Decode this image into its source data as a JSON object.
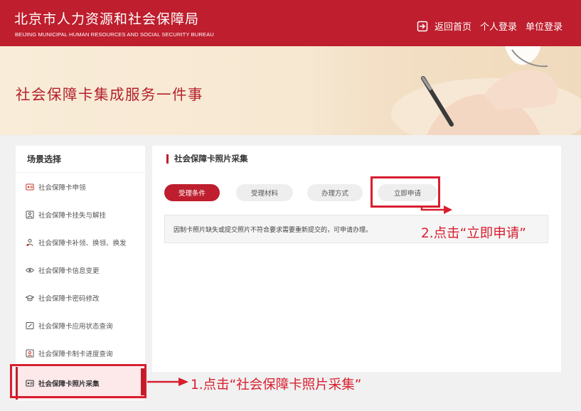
{
  "header": {
    "title_cn": "北京市人力资源和社会保障局",
    "title_en": "BEIJING MUNICIPAL HUMAN RESOURCES AND SOCIAL SECURITY BUREAU",
    "nav": {
      "home": "返回首页",
      "personal_login": "个人登录",
      "org_login": "单位登录"
    },
    "brand_color": "#be1e2d"
  },
  "banner": {
    "title": "社会保障卡集成服务一件事"
  },
  "sidebar": {
    "heading": "场景选择",
    "items": [
      {
        "label": "社会保障卡申领",
        "icon": "id-card-icon"
      },
      {
        "label": "社会保障卡挂失与解挂",
        "icon": "person-card-icon"
      },
      {
        "label": "社会保障卡补领、换领、换发",
        "icon": "person-refresh-icon"
      },
      {
        "label": "社会保障卡信息变更",
        "icon": "eye-icon"
      },
      {
        "label": "社会保障卡密码修改",
        "icon": "graduation-cap-icon"
      },
      {
        "label": "社会保障卡应用状态查询",
        "icon": "edit-box-icon"
      },
      {
        "label": "社会保障卡制卡进度查询",
        "icon": "person-box-icon"
      },
      {
        "label": "社会保障卡照片采集",
        "icon": "photo-card-icon",
        "active": true
      }
    ]
  },
  "main": {
    "title": "社会保障卡照片采集",
    "tabs": [
      {
        "label": "受理条件",
        "active": true
      },
      {
        "label": "受理材料"
      },
      {
        "label": "办理方式"
      },
      {
        "label": "立即申请"
      }
    ],
    "notice": "因制卡照片缺失或提交照片不符合要求需要重新提交的，可申请办理。"
  },
  "annotations": {
    "step1": "1.点击“社会保障卡照片采集”",
    "step2": "2.点击“立即申请”",
    "color": "#d81e2f"
  }
}
